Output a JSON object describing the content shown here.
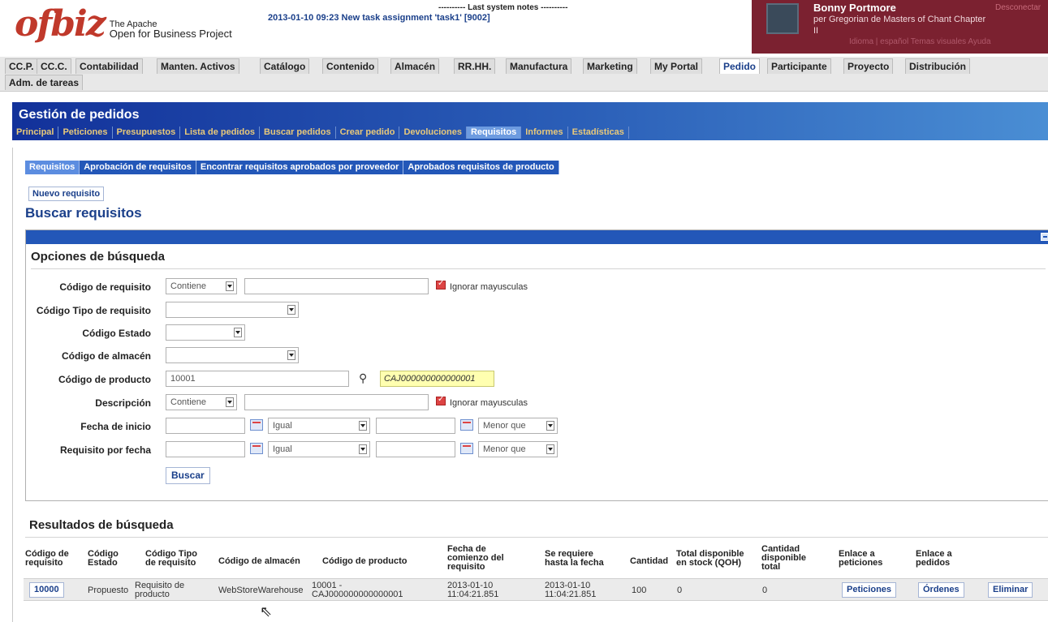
{
  "header": {
    "logo_mark": "ofbiz",
    "logo_sub_top": "The Apache",
    "logo_sub_bottom": "Open for Business Project",
    "system_notes_title": "---------- Last system notes ----------",
    "system_notes_message": "2013-01-10 09:23 New task assignment 'task1' [9002]",
    "user_name": "Bonny Portmore",
    "user_org": "per Gregorian de Masters of Chant Chapter",
    "user_org2": "II",
    "logout": "Desconectar",
    "user_links": "Idioma | español  Temas visuales  Ayuda"
  },
  "app_tabs": [
    {
      "label": "CC.P.",
      "active": false
    },
    {
      "label": "CC.C.",
      "active": false
    },
    {
      "label": "Contabilidad",
      "active": false
    },
    {
      "label": "Manten. Activos",
      "active": false
    },
    {
      "label": "Catálogo",
      "active": false
    },
    {
      "label": "Contenido",
      "active": false
    },
    {
      "label": "Almacén",
      "active": false
    },
    {
      "label": "RR.HH.",
      "active": false
    },
    {
      "label": "Manufactura",
      "active": false
    },
    {
      "label": "Marketing",
      "active": false
    },
    {
      "label": "My Portal",
      "active": false
    },
    {
      "label": "Pedido",
      "active": true
    },
    {
      "label": "Participante",
      "active": false
    },
    {
      "label": "Proyecto",
      "active": false
    },
    {
      "label": "Distribución",
      "active": false
    },
    {
      "label": "Adm. de tareas",
      "active": false
    }
  ],
  "banner": {
    "title": "Gestión de pedidos",
    "tabs": [
      {
        "label": "Principal",
        "active": false
      },
      {
        "label": "Peticiones",
        "active": false
      },
      {
        "label": "Presupuestos",
        "active": false
      },
      {
        "label": "Lista de pedidos",
        "active": false
      },
      {
        "label": "Buscar pedidos",
        "active": false
      },
      {
        "label": "Crear pedido",
        "active": false
      },
      {
        "label": "Devoluciones",
        "active": false
      },
      {
        "label": "Requisitos",
        "active": true
      },
      {
        "label": "Informes",
        "active": false
      },
      {
        "label": "Estadísticas",
        "active": false
      }
    ]
  },
  "req_tabs": [
    {
      "label": "Requisitos",
      "active": true
    },
    {
      "label": "Aprobación de requisitos",
      "active": false
    },
    {
      "label": "Encontrar requisitos aprobados por proveedor",
      "active": false
    },
    {
      "label": "Aprobados requisitos de producto",
      "active": false
    }
  ],
  "new_button": "Nuevo requisito",
  "page_title": "Buscar requisitos",
  "search": {
    "title": "Opciones de búsqueda",
    "fields": {
      "req_id_label": "Código de requisito",
      "req_id_op": "Contiene",
      "req_id_value": "",
      "ignore_case": "Ignorar mayusculas",
      "req_type_label": "Código Tipo de requisito",
      "req_type_value": "",
      "status_label": "Código Estado",
      "status_value": "",
      "facility_label": "Código de almacén",
      "facility_value": "",
      "product_label": "Código de producto",
      "product_value": "10001",
      "product_name": "CAJ000000000000001",
      "desc_label": "Descripción",
      "desc_op": "Contiene",
      "desc_value": "",
      "start_label": "Fecha de inicio",
      "start_op1": "Igual",
      "start_op2": "Menor que",
      "bydate_label": "Requisito por fecha",
      "bydate_op1": "Igual",
      "bydate_op2": "Menor que"
    },
    "submit": "Buscar"
  },
  "results": {
    "title": "Resultados de búsqueda",
    "headers": {
      "h1a": "Código de",
      "h1b": "requisito",
      "h2a": "Código",
      "h2b": "Estado",
      "h3a": "Código Tipo",
      "h3b": "de requisito",
      "h4": "Código de almacén",
      "h5": "Código de producto",
      "h6a": "Fecha de",
      "h6b": "comienzo del",
      "h6c": "requisito",
      "h7a": "Se requiere",
      "h7b": "hasta la fecha",
      "h8": "Cantidad",
      "h9a": "Total disponible",
      "h9b": "en stock (QOH)",
      "h10a": "Cantidad",
      "h10b": "disponible",
      "h10c": "total",
      "h11a": "Enlace a",
      "h11b": "peticiones",
      "h12a": "Enlace a",
      "h12b": "pedidos"
    },
    "row": {
      "id": "10000",
      "status": "Propuesto",
      "type_a": "Requisito de",
      "type_b": "producto",
      "facility": "WebStoreWarehouse",
      "product_a": "10001 -",
      "product_b": "CAJ000000000000001",
      "start_a": "2013-01-10",
      "start_b": "11:04:21.851",
      "until_a": "2013-01-10",
      "until_b": "11:04:21.851",
      "qty": "100",
      "qoh": "0",
      "atp": "0",
      "link_requests": "Peticiones",
      "link_orders": "Órdenes",
      "delete": "Eliminar"
    }
  }
}
